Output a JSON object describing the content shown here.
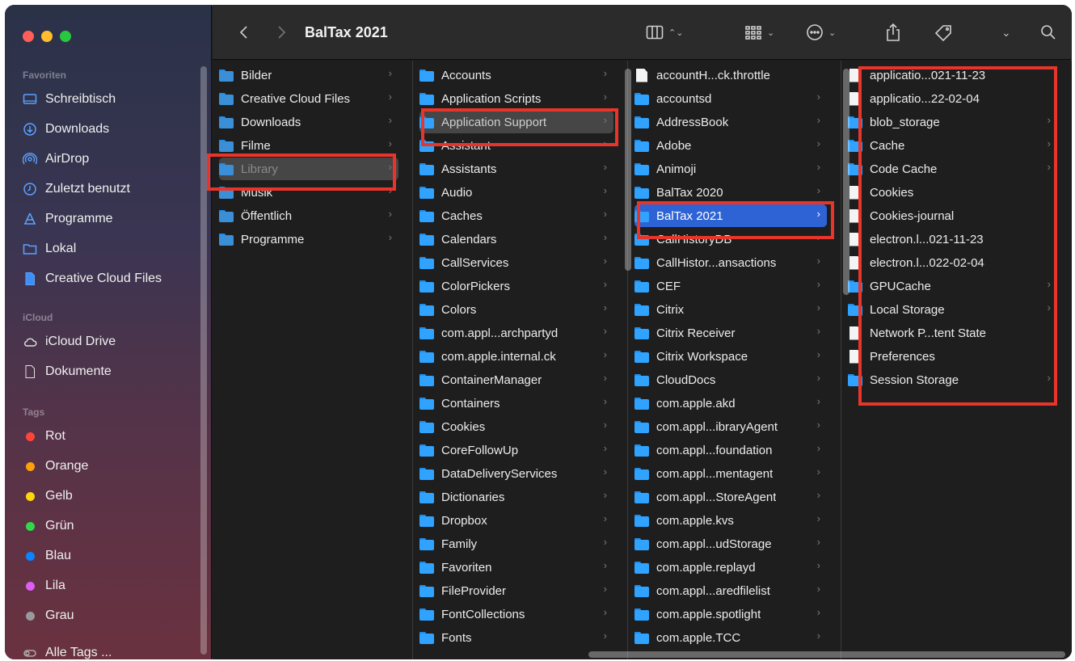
{
  "window": {
    "title": "BalTax 2021"
  },
  "sidebar": {
    "favorites_heading": "Favoriten",
    "favorites": [
      {
        "label": "Schreibtisch",
        "icon": "desktop-icon"
      },
      {
        "label": "Downloads",
        "icon": "download-icon"
      },
      {
        "label": "AirDrop",
        "icon": "airdrop-icon"
      },
      {
        "label": "Zuletzt benutzt",
        "icon": "clock-icon"
      },
      {
        "label": "Programme",
        "icon": "applications-icon"
      },
      {
        "label": "Lokal",
        "icon": "folder-icon"
      },
      {
        "label": "Creative Cloud Files",
        "icon": "document-icon"
      }
    ],
    "icloud_heading": "iCloud",
    "icloud": [
      {
        "label": "iCloud Drive",
        "icon": "cloud-icon"
      },
      {
        "label": "Dokumente",
        "icon": "document-icon"
      }
    ],
    "tags_heading": "Tags",
    "tags": [
      {
        "label": "Rot",
        "color": "#ff453a"
      },
      {
        "label": "Orange",
        "color": "#ff9f0a"
      },
      {
        "label": "Gelb",
        "color": "#ffd60a"
      },
      {
        "label": "Grün",
        "color": "#32d74b"
      },
      {
        "label": "Blau",
        "color": "#0a84ff"
      },
      {
        "label": "Lila",
        "color": "#da5ff2"
      },
      {
        "label": "Grau",
        "color": "#98989d"
      }
    ],
    "all_tags": "Alle Tags ..."
  },
  "columns": [
    {
      "items": [
        {
          "label": "Bilder",
          "type": "folder",
          "chevron": true
        },
        {
          "label": "Creative Cloud Files",
          "type": "folder",
          "chevron": true
        },
        {
          "label": "Downloads",
          "type": "folder",
          "chevron": true
        },
        {
          "label": "Filme",
          "type": "folder",
          "chevron": true
        },
        {
          "label": "Library",
          "type": "folder",
          "chevron": true,
          "selected": "inactive"
        },
        {
          "label": "Musik",
          "type": "folder",
          "chevron": true
        },
        {
          "label": "Öffentlich",
          "type": "folder",
          "chevron": true
        },
        {
          "label": "Programme",
          "type": "folder",
          "chevron": true
        }
      ]
    },
    {
      "items": [
        {
          "label": "Accounts",
          "type": "folder",
          "chevron": true
        },
        {
          "label": "Application Scripts",
          "type": "folder",
          "chevron": true
        },
        {
          "label": "Application Support",
          "type": "folder",
          "chevron": true,
          "selected": "inactive"
        },
        {
          "label": "Assistant",
          "type": "folder",
          "chevron": true
        },
        {
          "label": "Assistants",
          "type": "folder",
          "chevron": true
        },
        {
          "label": "Audio",
          "type": "folder",
          "chevron": true
        },
        {
          "label": "Caches",
          "type": "folder",
          "chevron": true
        },
        {
          "label": "Calendars",
          "type": "folder",
          "chevron": true
        },
        {
          "label": "CallServices",
          "type": "folder",
          "chevron": true
        },
        {
          "label": "ColorPickers",
          "type": "folder",
          "chevron": true
        },
        {
          "label": "Colors",
          "type": "folder",
          "chevron": true
        },
        {
          "label": "com.appl...archpartyd",
          "type": "folder",
          "chevron": true
        },
        {
          "label": "com.apple.internal.ck",
          "type": "folder",
          "chevron": true
        },
        {
          "label": "ContainerManager",
          "type": "folder",
          "chevron": true
        },
        {
          "label": "Containers",
          "type": "folder",
          "chevron": true
        },
        {
          "label": "Cookies",
          "type": "folder",
          "chevron": true
        },
        {
          "label": "CoreFollowUp",
          "type": "folder",
          "chevron": true
        },
        {
          "label": "DataDeliveryServices",
          "type": "folder",
          "chevron": true
        },
        {
          "label": "Dictionaries",
          "type": "folder",
          "chevron": true
        },
        {
          "label": "Dropbox",
          "type": "folder",
          "chevron": true
        },
        {
          "label": "Family",
          "type": "folder",
          "chevron": true
        },
        {
          "label": "Favoriten",
          "type": "folder",
          "chevron": true
        },
        {
          "label": "FileProvider",
          "type": "folder",
          "chevron": true
        },
        {
          "label": "FontCollections",
          "type": "folder",
          "chevron": true
        },
        {
          "label": "Fonts",
          "type": "folder",
          "chevron": true
        }
      ]
    },
    {
      "items": [
        {
          "label": "accountH...ck.throttle",
          "type": "file",
          "chevron": false
        },
        {
          "label": "accountsd",
          "type": "folder",
          "chevron": true
        },
        {
          "label": "AddressBook",
          "type": "folder",
          "chevron": true
        },
        {
          "label": "Adobe",
          "type": "folder",
          "chevron": true
        },
        {
          "label": "Animoji",
          "type": "folder",
          "chevron": true
        },
        {
          "label": "BalTax 2020",
          "type": "folder",
          "chevron": true
        },
        {
          "label": "BalTax 2021",
          "type": "folder",
          "chevron": true,
          "selected": "active"
        },
        {
          "label": "CallHistoryDB",
          "type": "folder",
          "chevron": true
        },
        {
          "label": "CallHistor...ansactions",
          "type": "folder",
          "chevron": true
        },
        {
          "label": "CEF",
          "type": "folder",
          "chevron": true
        },
        {
          "label": "Citrix",
          "type": "folder",
          "chevron": true
        },
        {
          "label": "Citrix Receiver",
          "type": "folder",
          "chevron": true
        },
        {
          "label": "Citrix Workspace",
          "type": "folder",
          "chevron": true
        },
        {
          "label": "CloudDocs",
          "type": "folder",
          "chevron": true
        },
        {
          "label": "com.apple.akd",
          "type": "folder",
          "chevron": true
        },
        {
          "label": "com.appl...ibraryAgent",
          "type": "folder",
          "chevron": true
        },
        {
          "label": "com.appl...foundation",
          "type": "folder",
          "chevron": true
        },
        {
          "label": "com.appl...mentagent",
          "type": "folder",
          "chevron": true
        },
        {
          "label": "com.appl...StoreAgent",
          "type": "folder",
          "chevron": true
        },
        {
          "label": "com.apple.kvs",
          "type": "folder",
          "chevron": true
        },
        {
          "label": "com.appl...udStorage",
          "type": "folder",
          "chevron": true
        },
        {
          "label": "com.apple.replayd",
          "type": "folder",
          "chevron": true
        },
        {
          "label": "com.appl...aredfilelist",
          "type": "folder",
          "chevron": true
        },
        {
          "label": "com.apple.spotlight",
          "type": "folder",
          "chevron": true
        },
        {
          "label": "com.apple.TCC",
          "type": "folder",
          "chevron": true
        }
      ]
    },
    {
      "items": [
        {
          "label": "applicatio...021-11-23",
          "type": "file",
          "chevron": false
        },
        {
          "label": "applicatio...22-02-04",
          "type": "file",
          "chevron": false
        },
        {
          "label": "blob_storage",
          "type": "folder",
          "chevron": true
        },
        {
          "label": "Cache",
          "type": "folder",
          "chevron": true
        },
        {
          "label": "Code Cache",
          "type": "folder",
          "chevron": true
        },
        {
          "label": "Cookies",
          "type": "file",
          "chevron": false
        },
        {
          "label": "Cookies-journal",
          "type": "file",
          "chevron": false
        },
        {
          "label": "electron.l...021-11-23",
          "type": "file",
          "chevron": false
        },
        {
          "label": "electron.l...022-02-04",
          "type": "file",
          "chevron": false
        },
        {
          "label": "GPUCache",
          "type": "folder",
          "chevron": true
        },
        {
          "label": "Local Storage",
          "type": "folder",
          "chevron": true
        },
        {
          "label": "Network P...tent State",
          "type": "file",
          "chevron": false
        },
        {
          "label": "Preferences",
          "type": "file",
          "chevron": false
        },
        {
          "label": "Session Storage",
          "type": "folder",
          "chevron": true
        }
      ]
    }
  ],
  "colors": {
    "highlight": "#e8352b",
    "selection": "#2e63d6",
    "folder": "#2fa3ff"
  }
}
